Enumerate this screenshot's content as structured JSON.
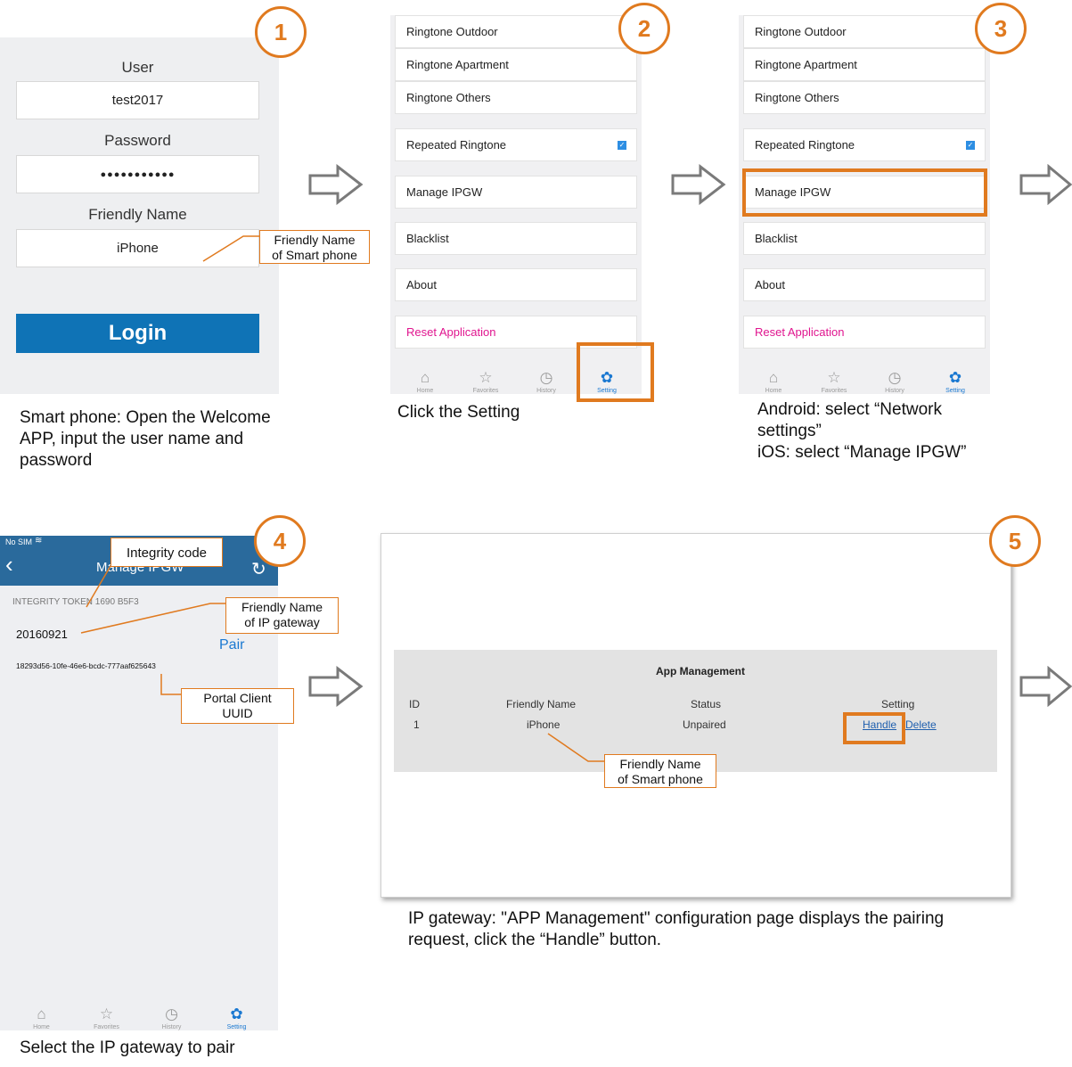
{
  "steps": [
    "1",
    "2",
    "3",
    "4",
    "5"
  ],
  "login": {
    "user_label": "User",
    "user_value": "test2017",
    "password_label": "Password",
    "password_value": "●●●●●●●●●●●",
    "friendly_label": "Friendly Name",
    "friendly_value": "iPhone",
    "login_button": "Login"
  },
  "settings": {
    "items": [
      "Ringtone Outdoor",
      "Ringtone Apartment",
      "Ringtone Others",
      "Repeated Ringtone",
      "Manage IPGW",
      "Blacklist",
      "About",
      "Reset Application"
    ],
    "reset_color": "#e0158f"
  },
  "tabs": [
    "Home",
    "Favorites",
    "History",
    "Setting"
  ],
  "ipgw": {
    "status": "No SIM",
    "title": "Manage IPGW",
    "token": "INTEGRITY TOKEN 1690 B5F3",
    "gateway_name": "20160921",
    "pair": "Pair",
    "uuid": "18293d56-10fe-46e6-bcdc-777aaf625643"
  },
  "callouts": {
    "friendly_phone_1": "Friendly Name",
    "friendly_phone_2": "of Smart phone",
    "integrity": "Integrity code",
    "friendly_gw_1": "Friendly Name",
    "friendly_gw_2": "of IP gateway",
    "uuid_1": "Portal Client",
    "uuid_2": "UUID"
  },
  "app_management": {
    "title": "App Management",
    "headers": [
      "ID",
      "Friendly Name",
      "Status",
      "Setting"
    ],
    "row": {
      "id": "1",
      "name": "iPhone",
      "status": "Unpaired",
      "handle": "Handle",
      "delete": "Delete"
    }
  },
  "captions": {
    "c1": [
      "Smart phone: Open the Welcome",
      "APP, input the user name and",
      "password"
    ],
    "c2": "Click the Setting",
    "c3": [
      "Android: select “Network",
      "settings”",
      "iOS: select “Manage IPGW”"
    ],
    "c4": "Select the IP gateway to pair",
    "c5": [
      "IP gateway: \"APP Management\" configuration page displays the pairing",
      "request, click the “Handle” button."
    ]
  },
  "colors": {
    "accent": "#e07a1f",
    "login_blue": "#0f73b6",
    "nav_blue": "#2a6a9c",
    "link_blue": "#1f5fae"
  }
}
